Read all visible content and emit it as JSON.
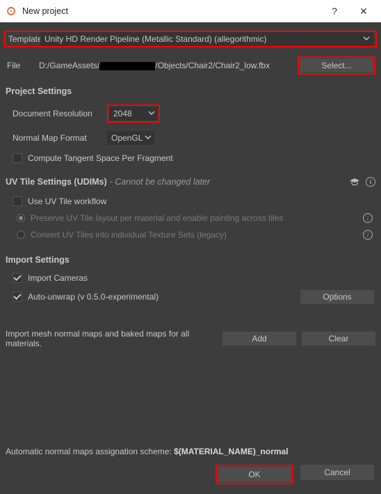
{
  "window": {
    "title": "New project",
    "help_glyph": "?",
    "close_glyph": "✕"
  },
  "template": {
    "label": "Template",
    "value": "Unity HD Render Pipeline (Metallic Standard) (allegorithmic)"
  },
  "file": {
    "label": "File",
    "path_prefix": "D:/GameAssets/",
    "path_suffix": "/Objects/Chair2/Chair2_low.fbx",
    "select_label": "Select..."
  },
  "project_settings": {
    "title": "Project Settings",
    "doc_res_label": "Document Resolution",
    "doc_res_value": "2048",
    "normal_label": "Normal Map Format",
    "normal_value": "OpenGL",
    "tangent_label": "Compute Tangent Space Per Fragment"
  },
  "uv": {
    "title": "UV Tile Settings (UDIMs)",
    "subtitle": " - Cannot be changed later",
    "workflow_label": "Use UV Tile workflow",
    "opt1": "Preserve UV Tile layout per material and enable painting across tiles",
    "opt2": "Convert UV Tiles into individual Texture Sets (legacy)"
  },
  "import": {
    "title": "Import Settings",
    "cameras_label": "Import Cameras",
    "autowrap_label": "Auto-unwrap (v 0.5.0-experimental)",
    "options_label": "Options"
  },
  "normal_maps": {
    "text": "Import mesh normal maps and baked maps for all materials.",
    "add_label": "Add",
    "clear_label": "Clear"
  },
  "footer": {
    "scheme_prefix": "Automatic normal maps assignation scheme: ",
    "scheme_value": "$(MATERIAL_NAME)_normal",
    "ok": "OK",
    "cancel": "Cancel"
  }
}
